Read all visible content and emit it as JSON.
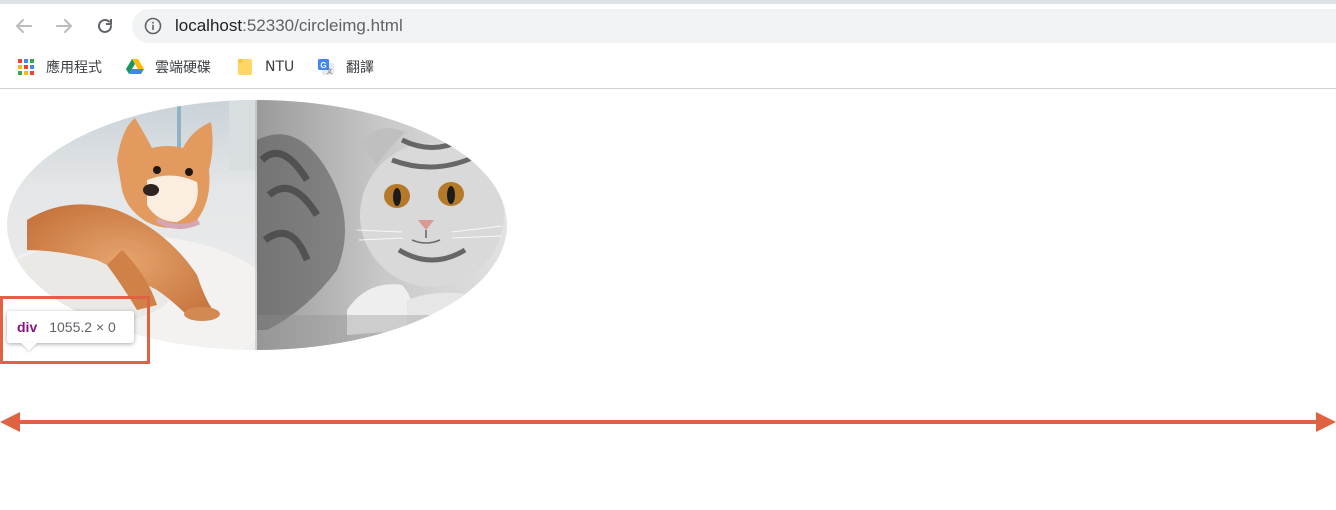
{
  "browser": {
    "url_host": "localhost",
    "url_rest": ":52330/circleimg.html",
    "icons": {
      "back": "arrow-left-icon",
      "forward": "arrow-right-icon",
      "reload": "reload-icon",
      "site_info": "info-icon"
    }
  },
  "bookmarks": [
    {
      "label": "應用程式",
      "icon": "apps-grid-icon"
    },
    {
      "label": "雲端硬碟",
      "icon": "google-drive-icon"
    },
    {
      "label": "NTU",
      "icon": "folder-icon"
    },
    {
      "label": "翻譯",
      "icon": "google-translate-icon"
    }
  ],
  "devtools_tooltip": {
    "tag": "div",
    "dimensions": "1055.2 × 0"
  },
  "colors": {
    "highlight": "#df6343",
    "tag": "#881280"
  }
}
